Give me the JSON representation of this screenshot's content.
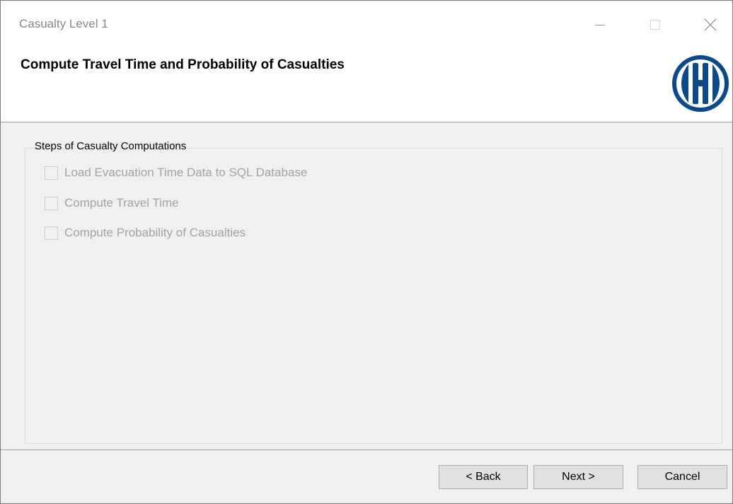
{
  "window": {
    "title": "Casualty Level 1"
  },
  "header": {
    "heading": "Compute Travel Time and Probability of Casualties",
    "logo_icon": "hazus-h-logo-icon",
    "logo_color": "#0a4a8c"
  },
  "steps_group": {
    "legend": "Steps of Casualty Computations",
    "items": [
      {
        "label": "Load Evacuation Time Data to SQL Database",
        "checked": false,
        "enabled": false
      },
      {
        "label": "Compute Travel Time",
        "checked": false,
        "enabled": false
      },
      {
        "label": "Compute Probability of Casualties",
        "checked": false,
        "enabled": false
      }
    ]
  },
  "footer": {
    "back_label": "< Back",
    "next_label": "Next >",
    "cancel_label": "Cancel"
  }
}
